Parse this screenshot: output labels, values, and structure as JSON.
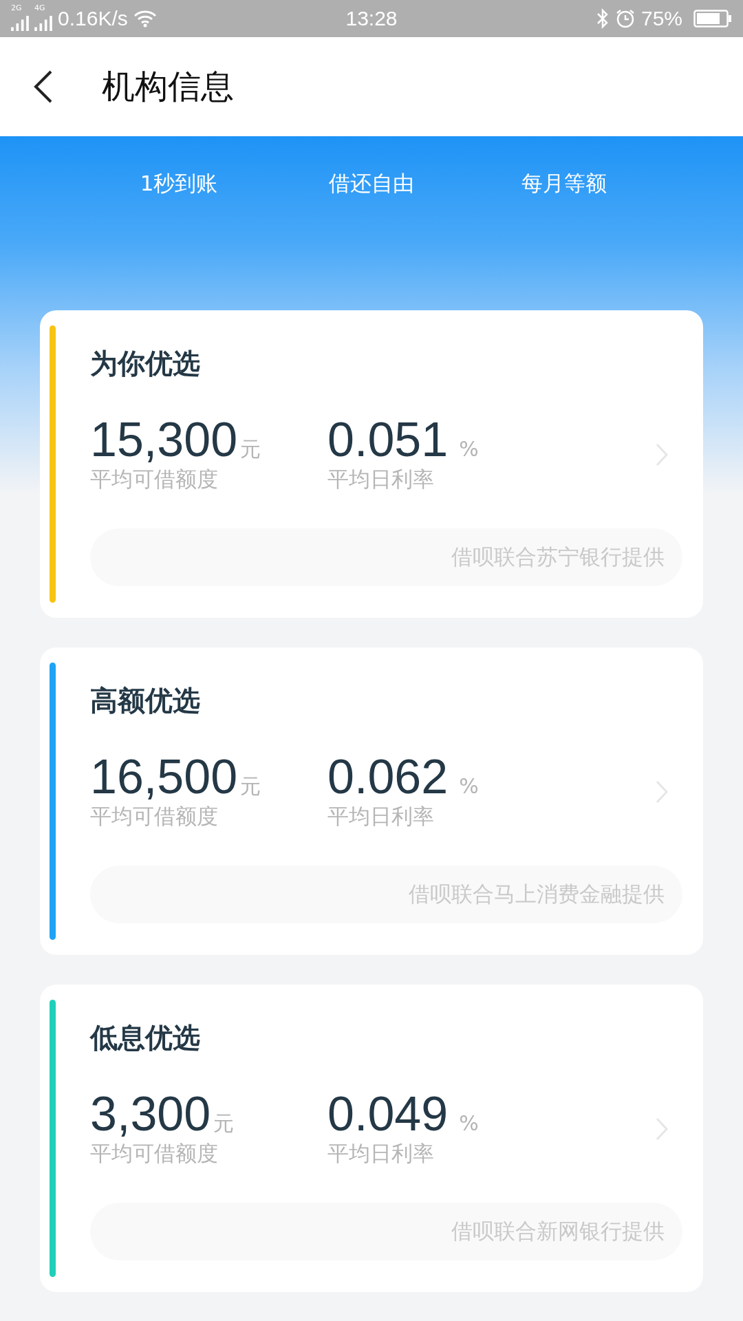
{
  "status_bar": {
    "sim_labels": [
      "2G",
      "4G"
    ],
    "speed": "0.16K/s",
    "time": "13:28",
    "battery": "75%"
  },
  "header": {
    "title": "机构信息"
  },
  "features": [
    "1秒到账",
    "借还自由",
    "每月等额"
  ],
  "cards": [
    {
      "title": "为你优选",
      "color": "#f7c414",
      "amount": "15,300",
      "amount_unit": "元",
      "amount_label": "平均可借额度",
      "rate": "0.051",
      "rate_unit": "%",
      "rate_label": "平均日利率",
      "provider": "借呗联合苏宁银行提供"
    },
    {
      "title": "高额优选",
      "color": "#1ea3f5",
      "amount": "16,500",
      "amount_unit": "元",
      "amount_label": "平均可借额度",
      "rate": "0.062",
      "rate_unit": "%",
      "rate_label": "平均日利率",
      "provider": "借呗联合马上消费金融提供"
    },
    {
      "title": "低息优选",
      "color": "#1fcfb9",
      "amount": "3,300",
      "amount_unit": "元",
      "amount_label": "平均可借额度",
      "rate": "0.049",
      "rate_unit": "%",
      "rate_label": "平均日利率",
      "provider": "借呗联合新网银行提供"
    }
  ]
}
